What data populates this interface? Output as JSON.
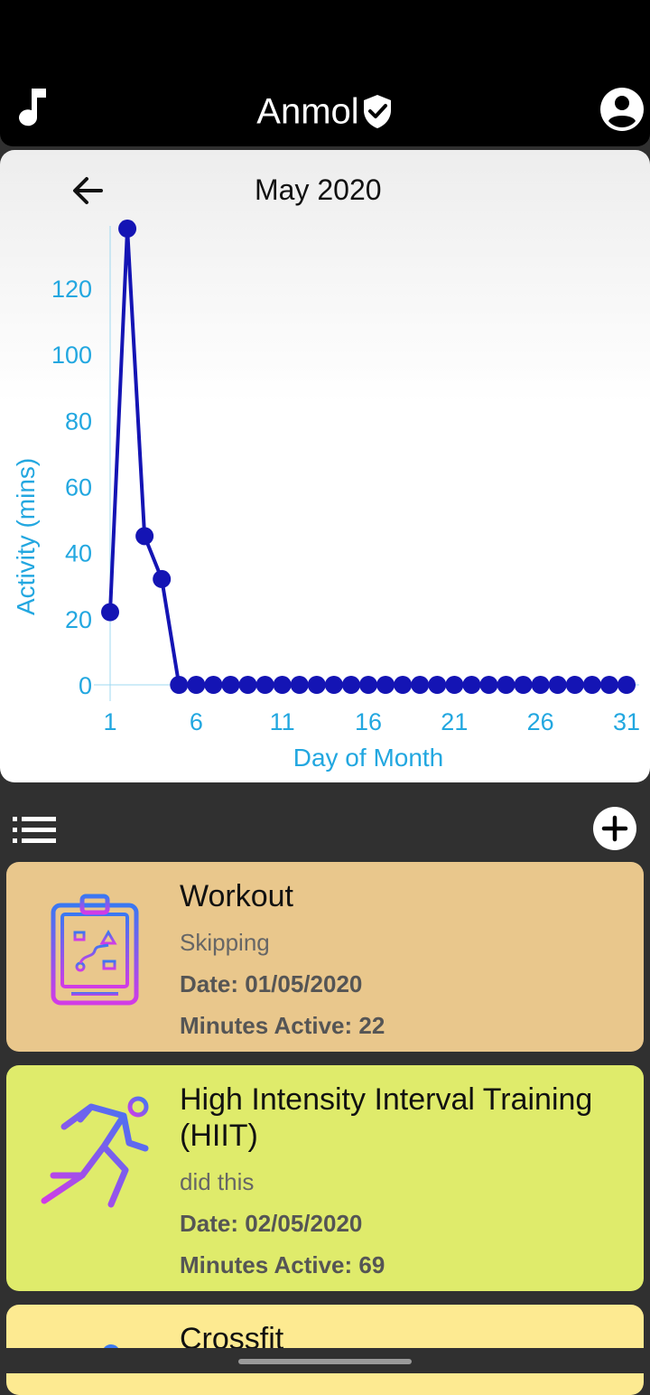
{
  "app": {
    "title": "Anmol"
  },
  "icons": {
    "music": "music-note-icon",
    "verified": "verified-shield-icon",
    "account": "account-circle-icon",
    "back": "arrow-left-icon",
    "list": "list-icon",
    "add": "add-circle-icon"
  },
  "chart": {
    "month_label": "May 2020"
  },
  "chart_data": {
    "type": "line",
    "xlabel": "Day of Month",
    "ylabel": "Activity (mins)",
    "x_ticks": [
      1,
      6,
      11,
      16,
      21,
      26,
      31
    ],
    "y_ticks": [
      0,
      20,
      40,
      60,
      80,
      100,
      120
    ],
    "xlim": [
      1,
      31
    ],
    "ylim": [
      0,
      135
    ],
    "x": [
      1,
      2,
      3,
      4,
      5,
      6,
      7,
      8,
      9,
      10,
      11,
      12,
      13,
      14,
      15,
      16,
      17,
      18,
      19,
      20,
      21,
      22,
      23,
      24,
      25,
      26,
      27,
      28,
      29,
      30,
      31
    ],
    "y": [
      22,
      138,
      45,
      32,
      0,
      0,
      0,
      0,
      0,
      0,
      0,
      0,
      0,
      0,
      0,
      0,
      0,
      0,
      0,
      0,
      0,
      0,
      0,
      0,
      0,
      0,
      0,
      0,
      0,
      0,
      0
    ],
    "line_color": "#1414b4",
    "axis_text_color": "#22a7e0"
  },
  "activities": [
    {
      "title": "Workout",
      "description": "Skipping",
      "date": "Date: 01/05/2020",
      "minutes": "Minutes Active: 22",
      "color": "#e9c78c",
      "icon": "clipboard-plan-icon"
    },
    {
      "title_line1": "High Intensity Interval Training",
      "title_line2": "(HIIT)",
      "description": "did this",
      "date": "Date: 02/05/2020",
      "minutes": "Minutes Active: 69",
      "color": "#dfeb6b",
      "icon": "running-person-icon"
    },
    {
      "title": "Crossfit",
      "color": "#fdea91"
    }
  ]
}
